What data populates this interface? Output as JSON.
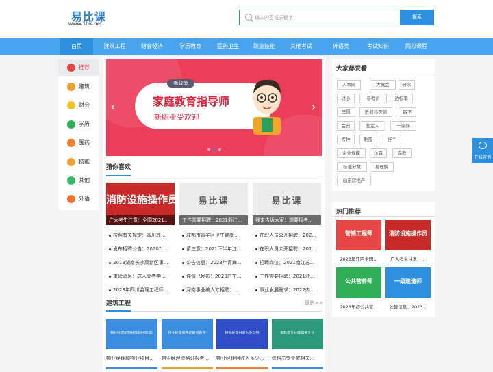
{
  "header": {
    "logo_text": "易比课",
    "logo_url": "www.1bk.net",
    "search_placeholder": "输入内容或关键字",
    "search_button": "搜索"
  },
  "nav": {
    "items": [
      {
        "label": "首页",
        "active": true
      },
      {
        "label": "建筑工程"
      },
      {
        "label": "财会经济"
      },
      {
        "label": "学历教育"
      },
      {
        "label": "医药卫生"
      },
      {
        "label": "职业技能"
      },
      {
        "label": "其他考试"
      },
      {
        "label": "外语类"
      },
      {
        "label": "考试知识"
      },
      {
        "label": "网校课程"
      }
    ]
  },
  "sidebar": {
    "items": [
      {
        "label": "推荐",
        "icon": "flame-icon",
        "color": "#e84545",
        "active": true
      },
      {
        "label": "建筑",
        "icon": "worker-icon",
        "color": "#f0a030"
      },
      {
        "label": "财会",
        "icon": "coin-icon",
        "color": "#f2c31b"
      },
      {
        "label": "学历",
        "icon": "graduation-cap-icon",
        "color": "#2fae55"
      },
      {
        "label": "医药",
        "icon": "hospital-icon",
        "color": "#f08030"
      },
      {
        "label": "技能",
        "icon": "helmet-icon",
        "color": "#f0a030"
      },
      {
        "label": "其他",
        "icon": "tube-icon",
        "color": "#3ab86a"
      },
      {
        "label": "外语",
        "icon": "book-icon",
        "color": "#f07030"
      }
    ]
  },
  "banner": {
    "tag": "新政策",
    "title": "家庭教育指导师",
    "subtitle": "新职业受欢迎",
    "prev": "‹",
    "next": "›"
  },
  "guess": {
    "title": "猜你喜欢",
    "cards": [
      {
        "label": "消防设施操作员",
        "caption": "广大考生注意：全国2021...",
        "color": "#c82a2a"
      },
      {
        "label": "易比课",
        "caption": "工作需要招聘：2021浙江...",
        "color": "#ececec"
      },
      {
        "label": "易比课",
        "caption": "我来告诉大家：想要报考...",
        "color": "#ececec"
      }
    ],
    "news": [
      [
        "按照有关规定：四川凉...",
        "成都市青羊区卫生健康...",
        "在职人员公开招聘：202..."
      ],
      [
        "发布招聘公告：2020？...",
        "请注意：2021下半年江...",
        "在职人员公开招聘：201..."
      ],
      [
        "2019湖南长沙高新区事...",
        "公告信息：2023年青海...",
        "招聘岗位：2021南江苏..."
      ],
      [
        "重磅消息：成人高考学...",
        "详情已发布：2020广东...",
        "工作需要招聘：2021浙..."
      ],
      [
        "2023年四川监理工程师...",
        "河南事业编人才招聘：...",
        "事业发展需求：2022内..."
      ]
    ]
  },
  "jianzhu": {
    "title": "建筑工程",
    "more": "更多>>",
    "items": [
      {
        "inner": "物业经理和物业项目经理证区别",
        "caption": "物业经理和物业项目...",
        "color": "#3a8de0"
      },
      {
        "inner": "物业经理资格证报考条件",
        "caption": "物业经理资格证报考...",
        "color": "#3a8de0"
      },
      {
        "inner": "物业经理月收入多少啊",
        "caption": "物业经理月收入多少...",
        "color": "#2f4fc8"
      },
      {
        "inner": "资料员专业或相关专业",
        "caption": "资料员专业或相关...",
        "color": "#2a9a7a"
      }
    ]
  },
  "popular": {
    "title": "大家都爱看",
    "tags": [
      "人事网",
      "大概会",
      "分水",
      "过心",
      "参考价",
      "达标率",
      "丰厚",
      "放射科医师",
      "取下",
      "会安",
      "鉴定人",
      "一家网",
      "考种",
      "制服",
      "许个",
      "企业规模",
      "尔森",
      "森教",
      "标准分数",
      "易理解",
      "山东房地产"
    ]
  },
  "hot": {
    "title": "热门推荐",
    "items": [
      {
        "label": "营销工程师",
        "caption": "2023年江西全国...",
        "color": "#e84545"
      },
      {
        "label": "消防设施操作员",
        "caption": "广大考生注意：...",
        "color": "#c82a2a"
      },
      {
        "label": "公共营养师",
        "caption": "2023年初公共营...",
        "color": "#2fae55"
      },
      {
        "label": "一级建造师",
        "caption": "公告信息：2023...",
        "color": "#2d8fe0"
      }
    ]
  },
  "float": {
    "label": "在线咨询"
  }
}
